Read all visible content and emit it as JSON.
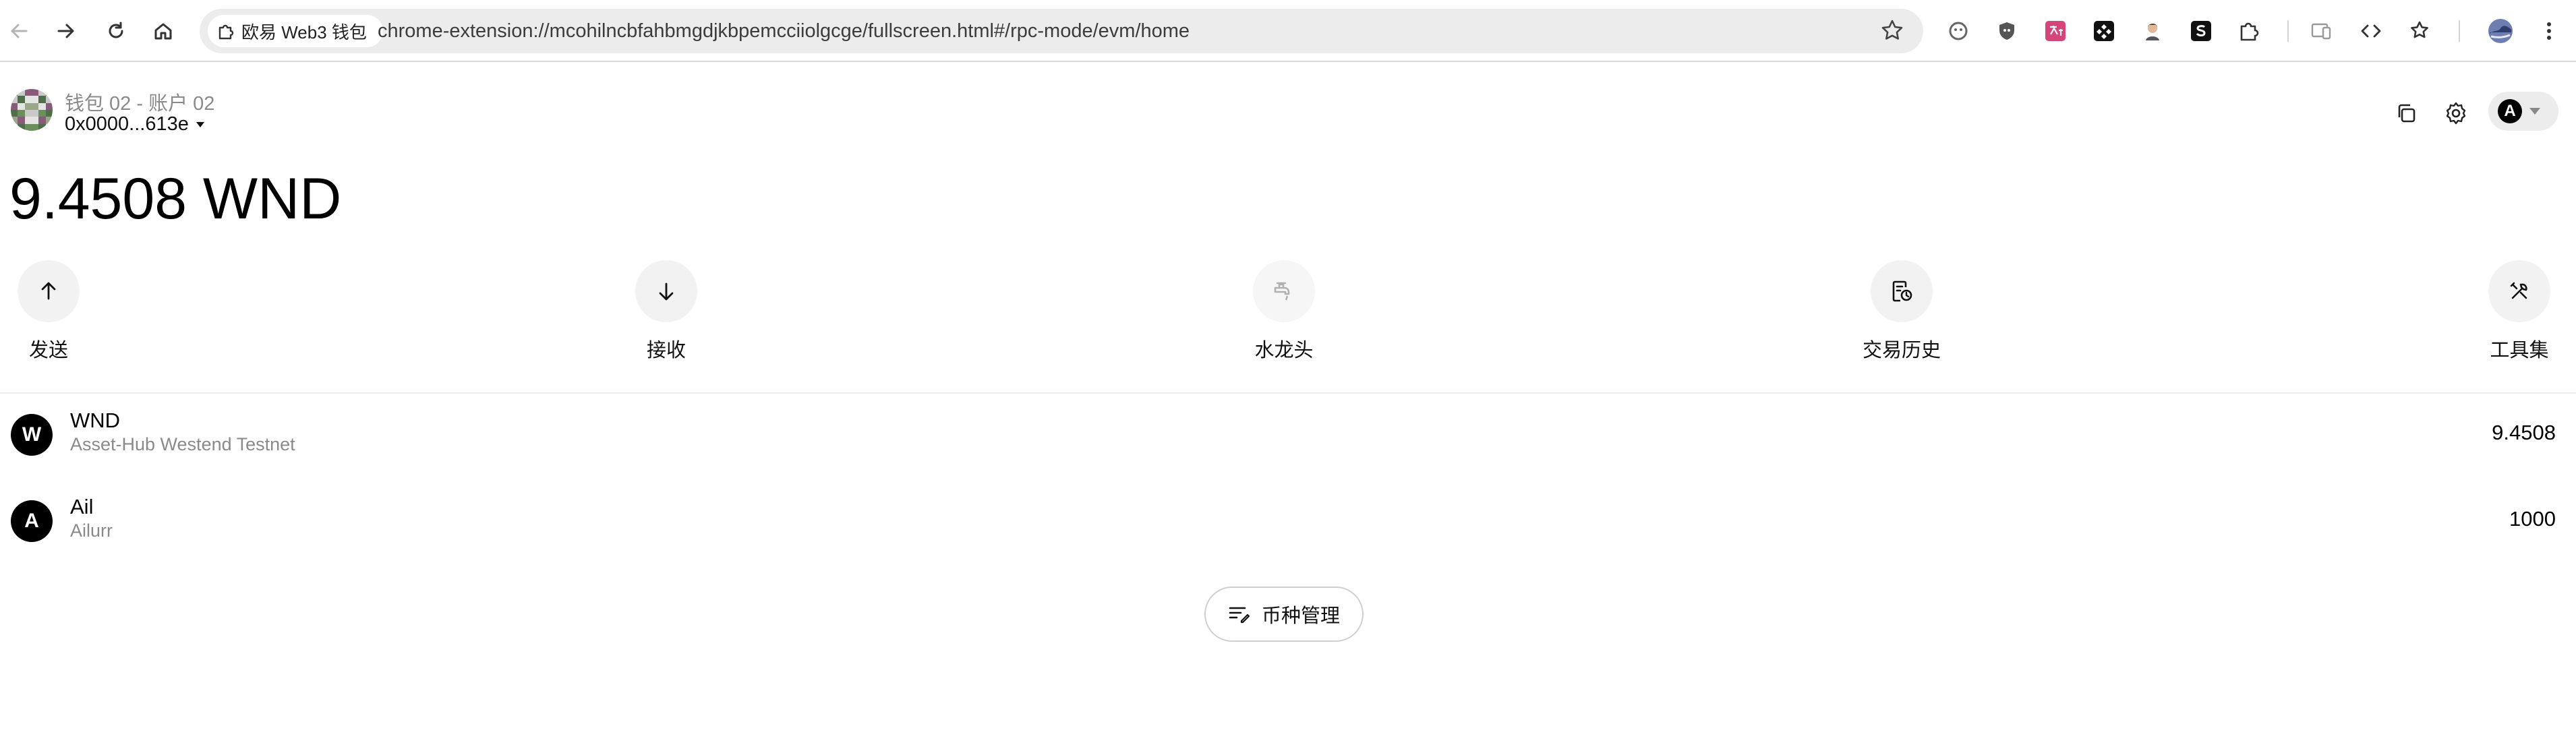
{
  "browser": {
    "extension_chip_label": "欧易 Web3 钱包",
    "url": "chrome-extension://mcohilncbfahbmgdjkbpemcciiolgcge/fullscreen.html#/rpc-mode/evm/home"
  },
  "header": {
    "wallet_name": "钱包 02 - 账户 02",
    "address": "0x0000...613e",
    "account_initial": "A"
  },
  "balance": "9.4508 WND",
  "actions": [
    {
      "label": "发送",
      "icon": "arrow-up-icon"
    },
    {
      "label": "接收",
      "icon": "arrow-down-icon"
    },
    {
      "label": "水龙头",
      "icon": "faucet-icon"
    },
    {
      "label": "交易历史",
      "icon": "history-icon"
    },
    {
      "label": "工具集",
      "icon": "tools-icon"
    }
  ],
  "tokens": [
    {
      "initial": "W",
      "symbol": "WND",
      "network": "Asset-Hub Westend Testnet",
      "amount": "9.4508"
    },
    {
      "initial": "A",
      "symbol": "Ail",
      "network": "Ailurr",
      "amount": "1000"
    }
  ],
  "manage_button": {
    "label": "币种管理"
  },
  "colors": {
    "accent": "#000000",
    "muted_text": "#8a8a8a",
    "action_bg": "#f2f2f2"
  }
}
